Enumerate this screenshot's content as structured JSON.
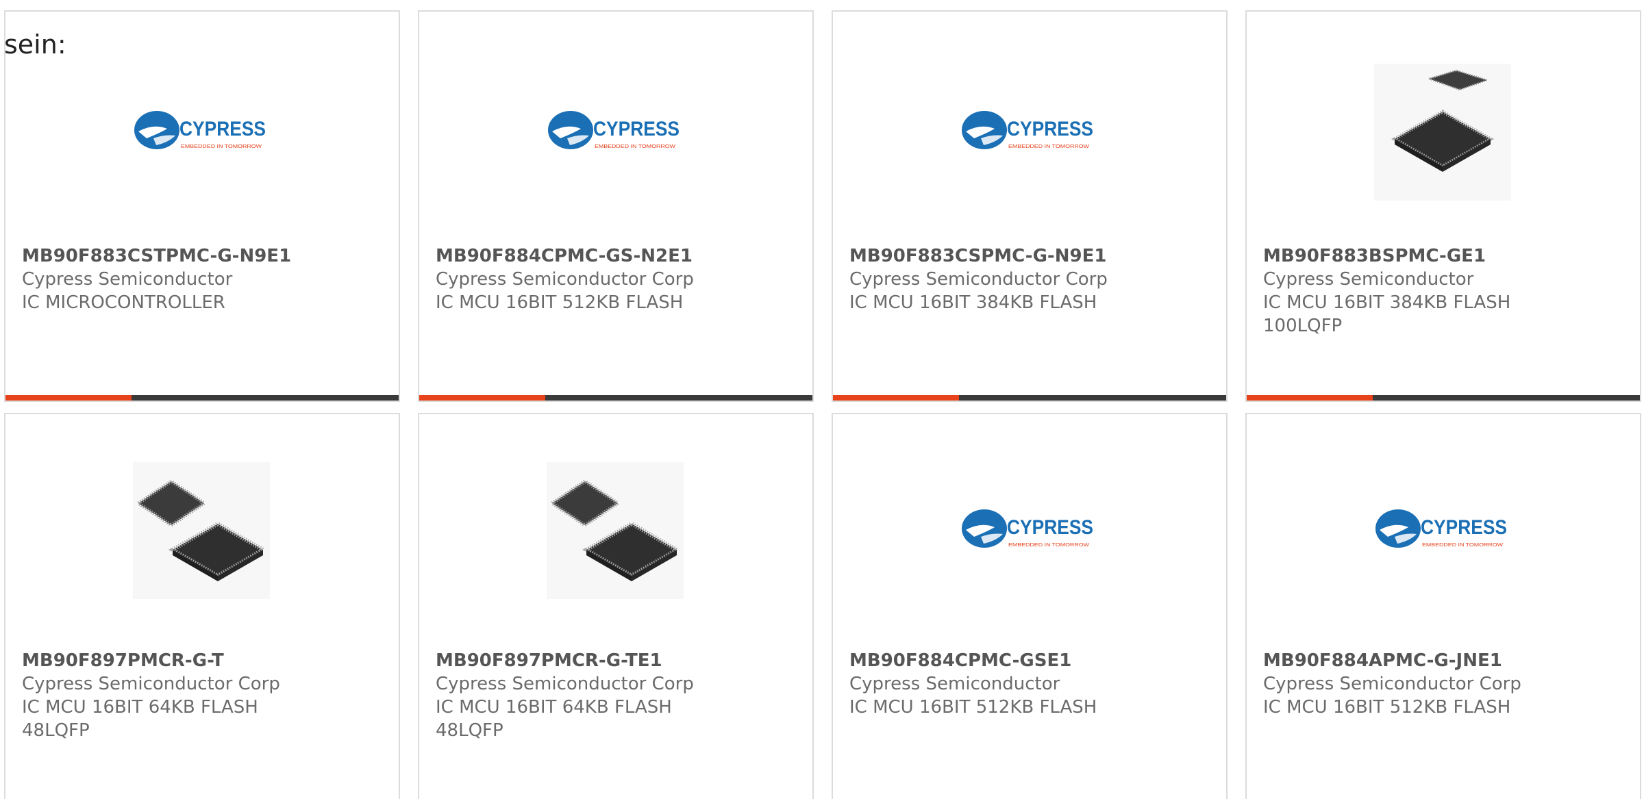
{
  "prefix_text": "sein:",
  "colors": {
    "accent": "#e8421b",
    "bar_dark": "#3a3a3a",
    "border": "#dcdcdc",
    "text": "#6b6b6b",
    "cypress_blue": "#1a6fb5",
    "cypress_red": "#e8421b"
  },
  "logo": {
    "wordmark": "CYPRESS",
    "tagline": "EMBEDDED IN TOMORROW"
  },
  "products": [
    {
      "part": "MB90F883CSTPMC-G-N9E1",
      "manufacturer": "Cypress Semiconductor",
      "desc1": "IC MICROCONTROLLER",
      "desc2": "",
      "image": "cypress-logo",
      "progress": 0.32
    },
    {
      "part": "MB90F884CPMC-GS-N2E1",
      "manufacturer": "Cypress Semiconductor Corp",
      "desc1": "IC MCU 16BIT 512KB FLASH",
      "desc2": "",
      "image": "cypress-logo",
      "progress": 0.32
    },
    {
      "part": "MB90F883CSPMC-G-N9E1",
      "manufacturer": "Cypress Semiconductor Corp",
      "desc1": "IC MCU 16BIT 384KB FLASH",
      "desc2": "",
      "image": "cypress-logo",
      "progress": 0.32
    },
    {
      "part": "MB90F883BSPMC-GE1",
      "manufacturer": "Cypress Semiconductor",
      "desc1": "IC MCU 16BIT 384KB FLASH",
      "desc2": "100LQFP",
      "image": "qfp-chips",
      "progress": 0.32
    },
    {
      "part": "MB90F897PMCR-G-T",
      "manufacturer": "Cypress Semiconductor Corp",
      "desc1": "IC MCU 16BIT 64KB FLASH",
      "desc2": "48LQFP",
      "image": "lqfp-chips",
      "progress": 0
    },
    {
      "part": "MB90F897PMCR-G-TE1",
      "manufacturer": "Cypress Semiconductor Corp",
      "desc1": "IC MCU 16BIT 64KB FLASH",
      "desc2": "48LQFP",
      "image": "lqfp-chips",
      "progress": 0
    },
    {
      "part": "MB90F884CPMC-GSE1",
      "manufacturer": "Cypress Semiconductor",
      "desc1": "IC MCU 16BIT 512KB FLASH",
      "desc2": "",
      "image": "cypress-logo",
      "progress": 0
    },
    {
      "part": "MB90F884APMC-G-JNE1",
      "manufacturer": "Cypress Semiconductor Corp",
      "desc1": "IC MCU 16BIT 512KB FLASH",
      "desc2": "",
      "image": "cypress-logo",
      "progress": 0
    }
  ]
}
